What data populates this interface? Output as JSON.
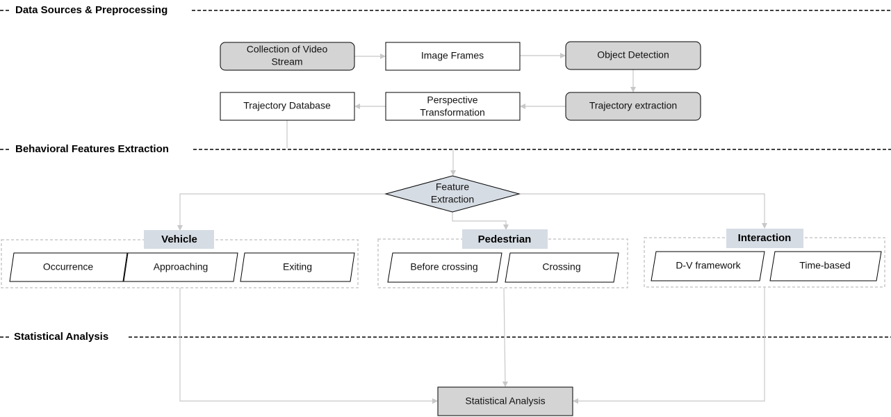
{
  "sections": [
    {
      "title": "Data Sources & Preprocessing"
    },
    {
      "title": "Behavioral Features Extraction"
    },
    {
      "title": "Statistical Analysis"
    }
  ],
  "preprocessing": {
    "collection": [
      "Collection of Video",
      "Stream"
    ],
    "image_frames": "Image Frames",
    "object_detection": "Object Detection",
    "trajectory_extraction": "Trajectory extraction",
    "perspective": [
      "Perspective",
      "Transformation"
    ],
    "trajectory_db": "Trajectory Database"
  },
  "feature_extraction": [
    "Feature",
    "Extraction"
  ],
  "groups": {
    "vehicle": {
      "label": "Vehicle",
      "items": [
        "Occurrence",
        "Approaching",
        "Exiting"
      ]
    },
    "pedestrian": {
      "label": "Pedestrian",
      "items": [
        "Before crossing",
        "Crossing"
      ]
    },
    "interaction": {
      "label": "Interaction",
      "items": [
        "D-V framework",
        "Time-based"
      ]
    }
  },
  "statistical_analysis": "Statistical Analysis",
  "colors": {
    "process_gray": "#d4d4d4",
    "group_tag": "#d6dce4",
    "connector": "#c8c8c8"
  }
}
